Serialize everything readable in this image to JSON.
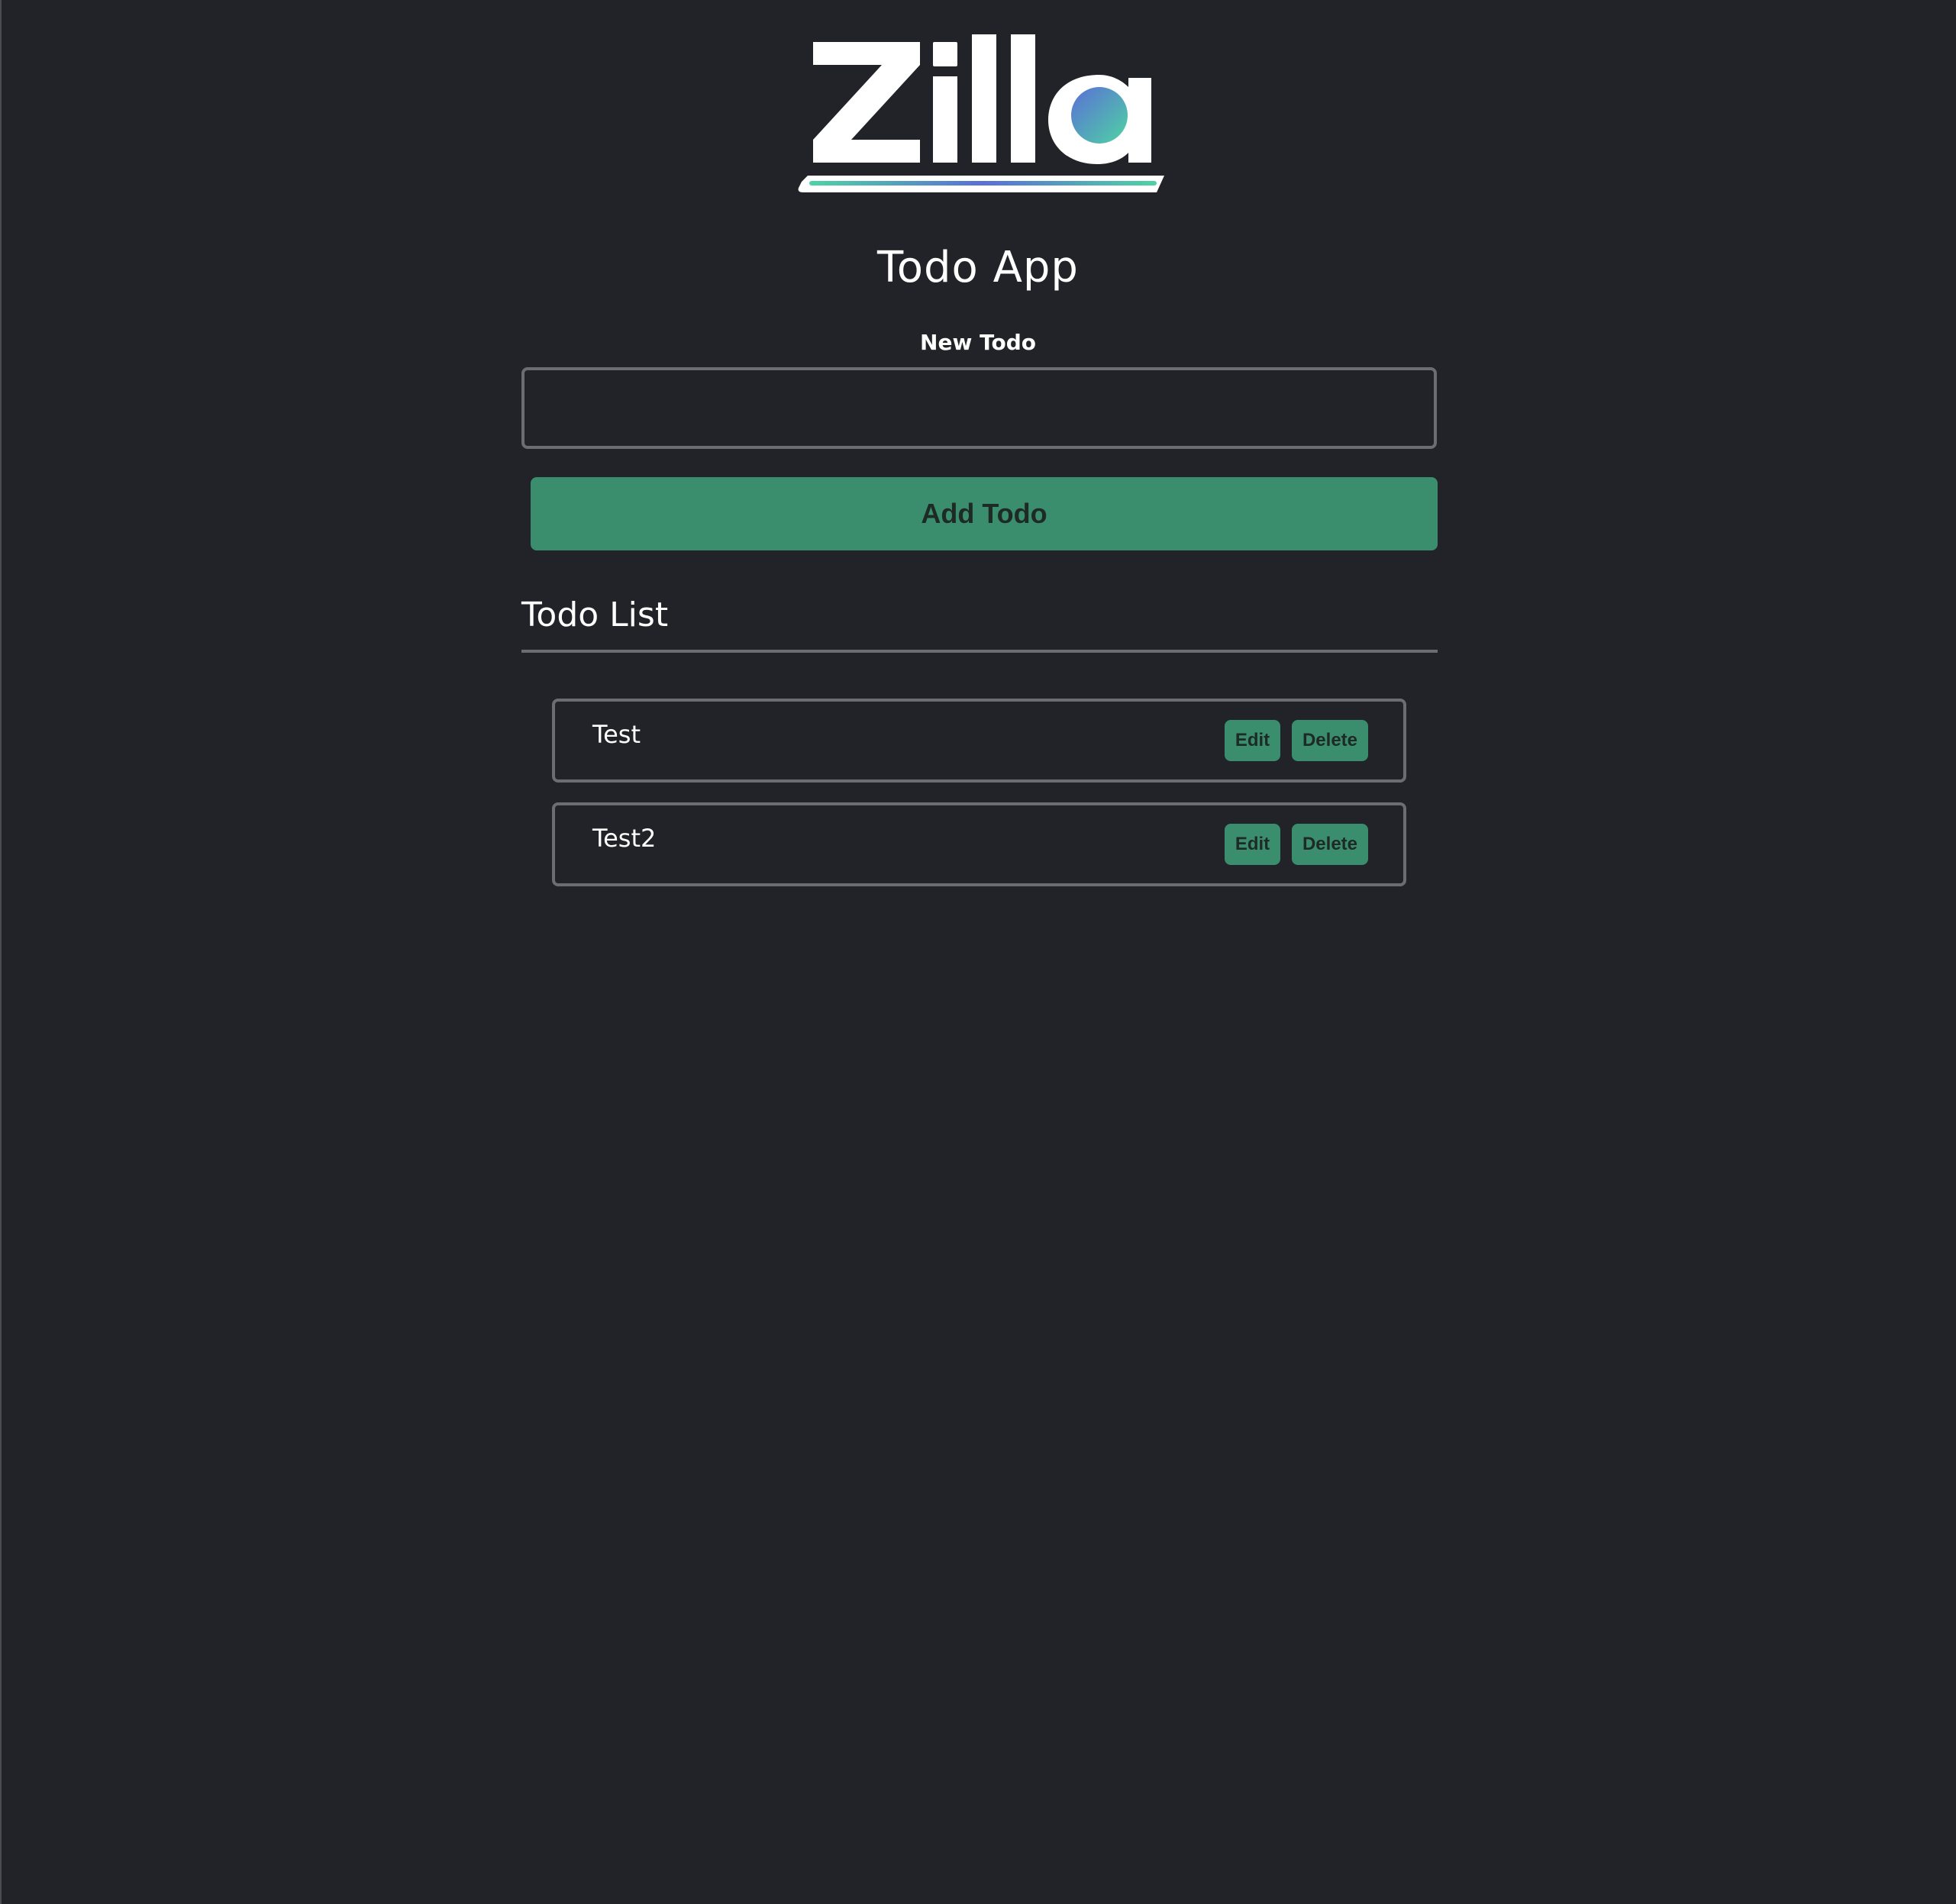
{
  "brand": {
    "logo_text": "Zilla",
    "colors": {
      "gradient_start": "#5a6fd6",
      "gradient_end": "#4fd3a4",
      "wordmark": "#ffffff"
    }
  },
  "header": {
    "title": "Todo App"
  },
  "form": {
    "label": "New Todo",
    "input_value": "",
    "input_placeholder": "",
    "submit_label": "Add Todo"
  },
  "list": {
    "heading": "Todo List",
    "items": [
      {
        "text": "Test",
        "edit_label": "Edit",
        "delete_label": "Delete"
      },
      {
        "text": "Test2",
        "edit_label": "Edit",
        "delete_label": "Delete"
      }
    ]
  },
  "theme": {
    "background": "#222328",
    "accent": "#3a8e6d",
    "border": "#6b6d72"
  }
}
